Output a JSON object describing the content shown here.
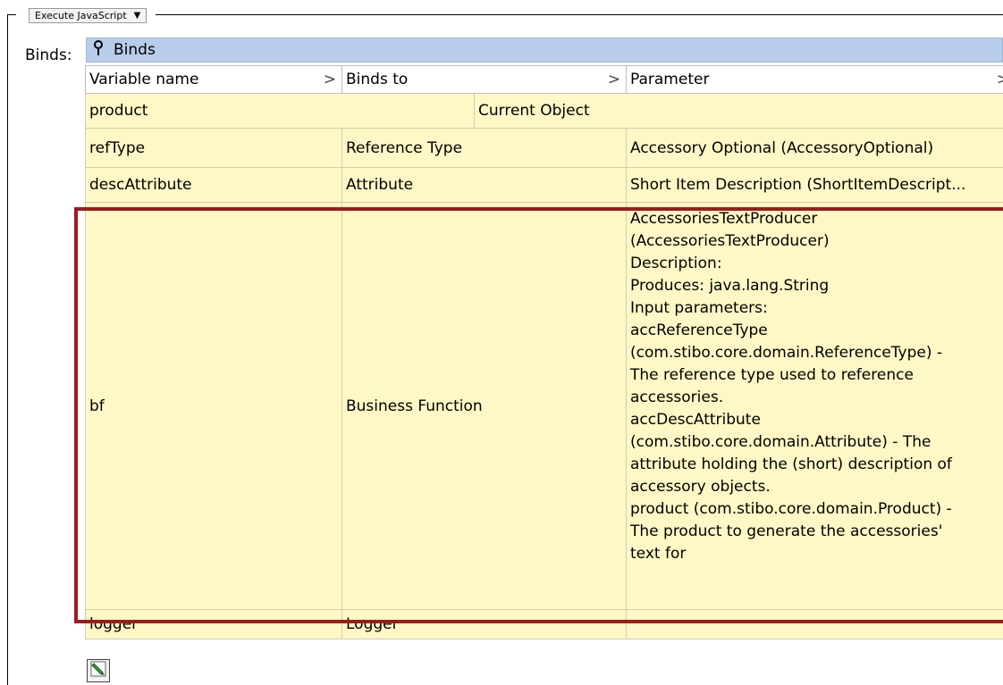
{
  "toolbar": {
    "execute_label": "Execute JavaScript",
    "execute_caret": "▼"
  },
  "binds": {
    "label": "Binds:",
    "bar_title": "Binds",
    "bar_icon": "pin-icon",
    "columns": [
      {
        "label": "Variable name",
        "arrow": ">"
      },
      {
        "label": "Binds to",
        "arrow": ">"
      },
      {
        "label": "Parameter",
        "arrow": ">"
      }
    ],
    "rows": [
      {
        "variable": "product",
        "binds_to": "Current Object",
        "parameter": ""
      },
      {
        "variable": "refType",
        "binds_to": "Reference Type",
        "parameter": "Accessory Optional (AccessoryOptional)"
      },
      {
        "variable": "descAttribute",
        "binds_to": "Attribute",
        "parameter": "Short Item Description (ShortItemDescript..."
      },
      {
        "variable": "bf",
        "binds_to": "Business Function",
        "parameter_lines": [
          "AccessoriesTextProducer",
          "(AccessoriesTextProducer)",
          "Description:",
          "Produces: java.lang.String",
          "Input parameters:",
          "accReferenceType",
          "(com.stibo.core.domain.ReferenceType) -",
          "The reference type used to reference",
          "accessories.",
          "accDescAttribute",
          "(com.stibo.core.domain.Attribute) - The",
          "attribute holding the (short) description of",
          "accessory objects.",
          "product (com.stibo.core.domain.Product) -",
          "The product to generate the accessories'",
          "text for"
        ]
      },
      {
        "variable": "logger",
        "binds_to": "Logger",
        "parameter": ""
      }
    ]
  },
  "icons": {
    "edit_button": "edit-pencil-icon"
  },
  "colors": {
    "header_bar": "#b7cdea",
    "row_bg": "#fff8c6",
    "highlight": "#9c1c1c"
  }
}
